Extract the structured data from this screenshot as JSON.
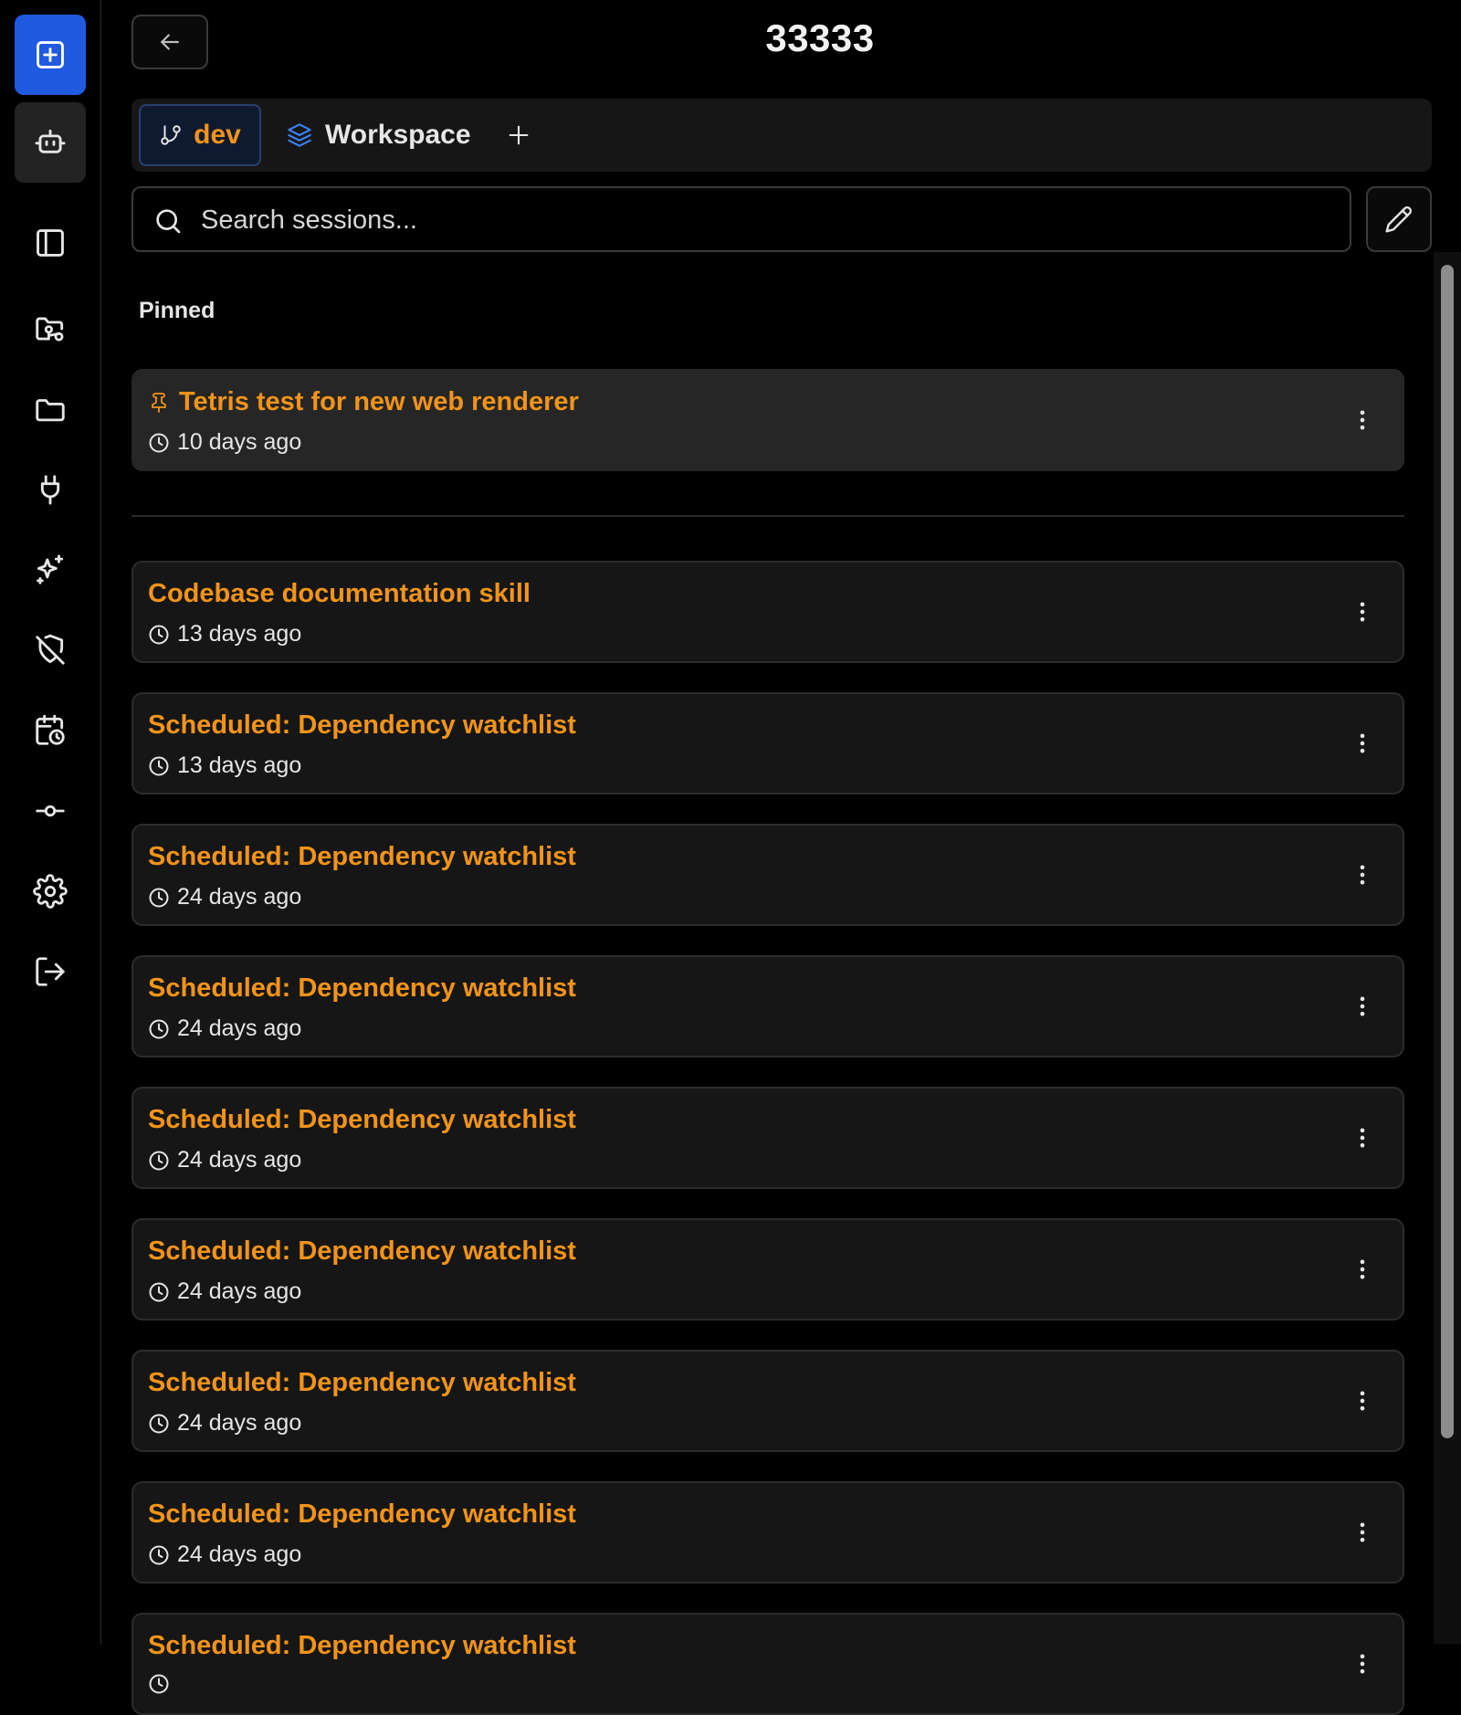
{
  "header": {
    "title": "33333"
  },
  "tabs": {
    "branch_label": "dev",
    "workspace_label": "Workspace"
  },
  "search": {
    "placeholder": "Search sessions..."
  },
  "pinned_label": "Pinned",
  "pinned_sessions": [
    {
      "title": "Tetris test for new web renderer",
      "time": "10 days ago"
    }
  ],
  "sessions": [
    {
      "title": "Codebase documentation skill",
      "time": "13 days ago"
    },
    {
      "title": "Scheduled: Dependency watchlist",
      "time": "13 days ago"
    },
    {
      "title": "Scheduled: Dependency watchlist",
      "time": "24 days ago"
    },
    {
      "title": "Scheduled: Dependency watchlist",
      "time": "24 days ago"
    },
    {
      "title": "Scheduled: Dependency watchlist",
      "time": "24 days ago"
    },
    {
      "title": "Scheduled: Dependency watchlist",
      "time": "24 days ago"
    },
    {
      "title": "Scheduled: Dependency watchlist",
      "time": "24 days ago"
    },
    {
      "title": "Scheduled: Dependency watchlist",
      "time": "24 days ago"
    },
    {
      "title": "Scheduled: Dependency watchlist",
      "time": ""
    }
  ],
  "colors": {
    "accent_orange": "#f29419",
    "primary_blue": "#1f5ae0",
    "background": "#000000",
    "card": "#161616",
    "pinned_card": "#262626"
  },
  "icons": {
    "rail": [
      "new-session-icon",
      "robot-icon",
      "sidebar-panel-icon",
      "folder-search-icon",
      "folder-icon",
      "plug-icon",
      "sparkles-icon",
      "shield-off-icon",
      "calendar-clock-icon",
      "git-commit-icon",
      "gear-icon",
      "logout-icon"
    ]
  }
}
